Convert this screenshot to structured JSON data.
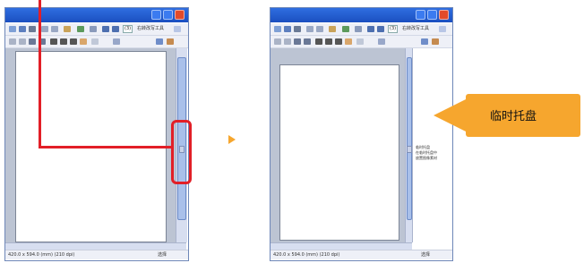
{
  "left_window": {
    "toolbar": {
      "zoom_value": "(3)",
      "zoom_label": "右转改写工具"
    },
    "status_text": "420.0 x 594.0 (mm) (210 dpi)",
    "status_right": "选择"
  },
  "right_window": {
    "toolbar": {
      "zoom_value": "(3)",
      "zoom_label": "右转改写工具"
    },
    "status_text": "420.0 x 594.0 (mm) (210 dpi)",
    "status_right": "选择",
    "tray_items": [
      "临时托盘",
      "在临时托盘中",
      "放置图像素材"
    ]
  },
  "step_arrow": "▶",
  "callout": {
    "text": "临时托盘",
    "color": "#f6a62e"
  },
  "highlight_color": "#e21f27"
}
